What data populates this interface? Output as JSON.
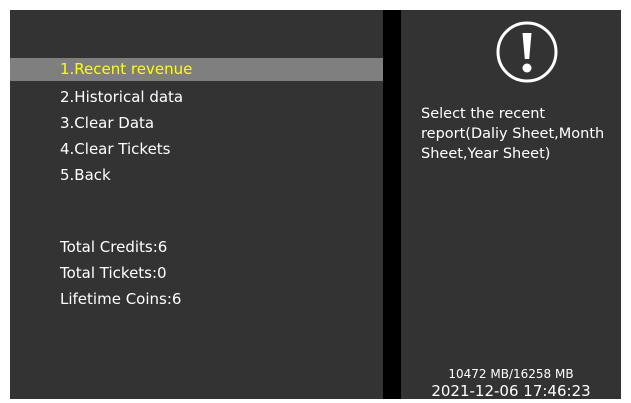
{
  "menu": {
    "items": [
      {
        "label": "1.Recent revenue"
      },
      {
        "label": "2.Historical data"
      },
      {
        "label": "3.Clear Data"
      },
      {
        "label": "4.Clear Tickets"
      },
      {
        "label": "5.Back"
      }
    ],
    "selected_index": 0
  },
  "stats": {
    "total_credits": "Total Credits:6",
    "total_tickets": "Total Tickets:0",
    "lifetime_coins": "Lifetime Coins:6"
  },
  "info": {
    "icon": "exclamation-circle-icon",
    "text": "Select the recent report(Daliy Sheet,Month Sheet,Year Sheet)"
  },
  "status": {
    "storage": "10472 MB/16258 MB",
    "datetime": "2021-12-06 17:46:23"
  },
  "colors": {
    "panel_bg": "#333333",
    "divider": "#000000",
    "highlight_bg": "#7f7f7f",
    "highlight_text": "#ffff00",
    "text": "#ffffff"
  }
}
